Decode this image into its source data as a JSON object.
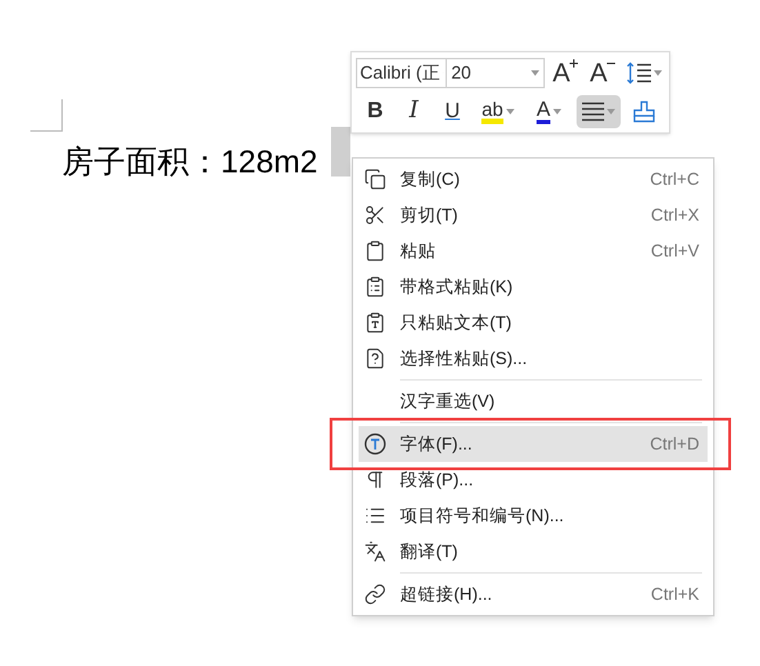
{
  "document": {
    "text": "房子面积：128m2"
  },
  "toolbar": {
    "font": "Calibri (正",
    "size": "20",
    "buttons": [
      {
        "kind": "grow",
        "label": "A",
        "selected": false
      },
      {
        "kind": "shrink",
        "label": "A",
        "selected": false
      },
      {
        "kind": "spacing",
        "selected": false
      },
      {
        "kind": "bold",
        "label": "B",
        "selected": false
      },
      {
        "kind": "italic",
        "label": "I",
        "selected": false
      },
      {
        "kind": "underline",
        "label": "U",
        "selected": false
      },
      {
        "kind": "highlight",
        "label": "ab",
        "selected": false
      },
      {
        "kind": "color",
        "label": "A",
        "selected": false
      },
      {
        "kind": "align",
        "selected": true
      },
      {
        "kind": "painter",
        "selected": false
      }
    ]
  },
  "menu": [
    {
      "kind": "item",
      "label": "复制(C)",
      "shortcut": "Ctrl+C",
      "selected": false
    },
    {
      "kind": "item",
      "label": "剪切(T)",
      "shortcut": "Ctrl+X",
      "selected": false
    },
    {
      "kind": "item",
      "label": "粘贴",
      "shortcut": "Ctrl+V",
      "selected": false
    },
    {
      "kind": "item",
      "label": "带格式粘贴(K)",
      "selected": false
    },
    {
      "kind": "item",
      "label": "只粘贴文本(T)",
      "selected": false
    },
    {
      "kind": "item",
      "label": "选择性粘贴(S)...",
      "selected": false
    },
    {
      "kind": "separator"
    },
    {
      "kind": "item",
      "label": "汉字重选(V)",
      "selected": false
    },
    {
      "kind": "separator"
    },
    {
      "kind": "item",
      "label": "字体(F)...",
      "shortcut": "Ctrl+D",
      "selected": true
    },
    {
      "kind": "item",
      "label": "段落(P)...",
      "selected": false
    },
    {
      "kind": "item",
      "label": "项目符号和编号(N)...",
      "selected": false
    },
    {
      "kind": "item",
      "label": "翻译(T)",
      "selected": false
    },
    {
      "kind": "separator"
    },
    {
      "kind": "item",
      "label": "超链接(H)...",
      "shortcut": "Ctrl+K",
      "selected": false
    }
  ]
}
